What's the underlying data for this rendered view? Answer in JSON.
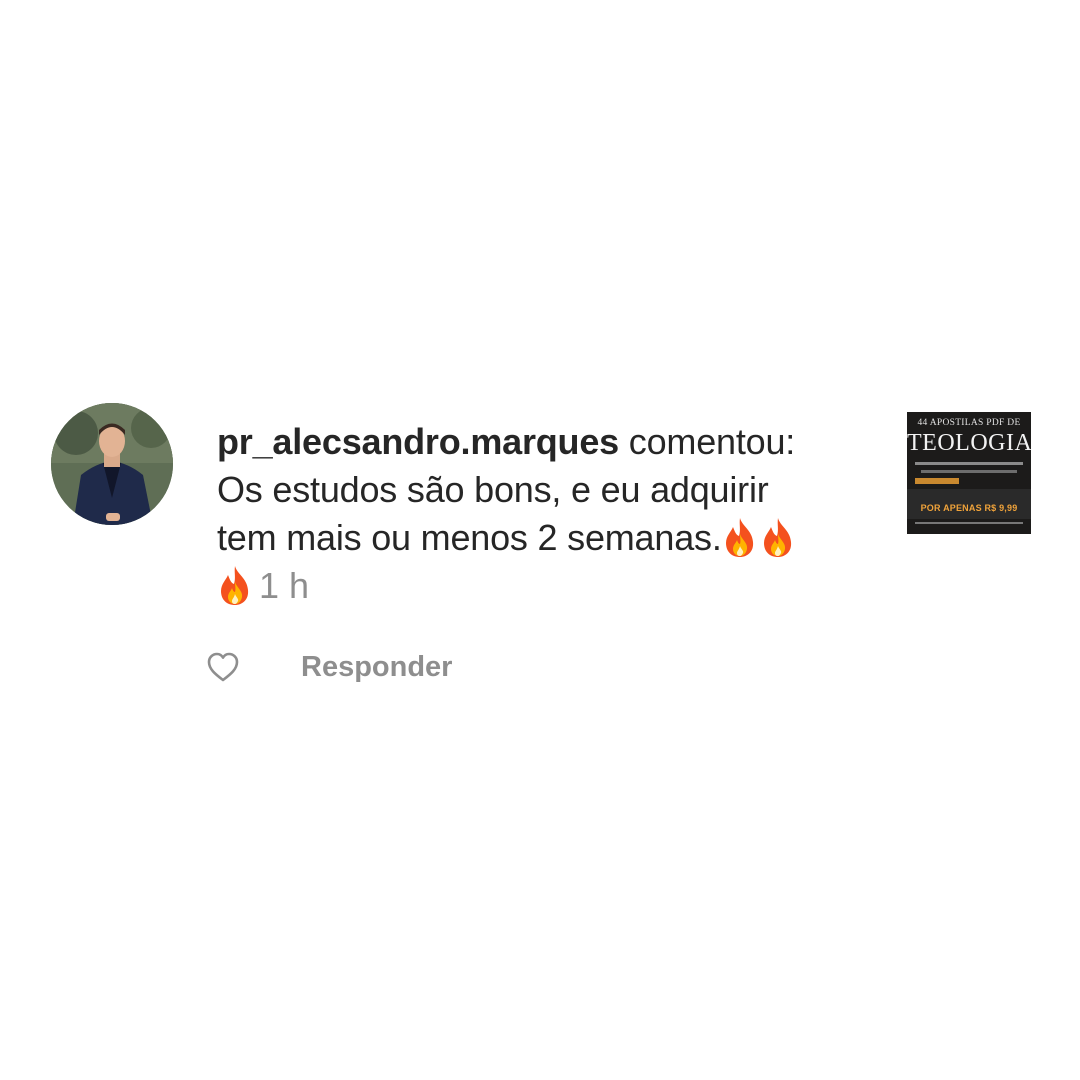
{
  "comment": {
    "username": "pr_alecsandro.marques",
    "action": "comentou:",
    "line1": "Os estudos são bons, e eu adquirir",
    "line2": "tem mais ou menos 2 semanas.",
    "emoji": "fire-emoji",
    "emoji_count": 3,
    "timestamp": "1 h"
  },
  "actions": {
    "like_icon": "heart-outline-icon",
    "reply_label": "Responder"
  },
  "post_thumbnail": {
    "top_text": "44 APOSTILAS PDF DE",
    "title": "TEOLOGIA",
    "price_text": "POR APENAS R$ 9,99"
  },
  "colors": {
    "text": "#262626",
    "secondary": "#8e8e8e",
    "background": "#ffffff",
    "fire": "#f4511e"
  }
}
